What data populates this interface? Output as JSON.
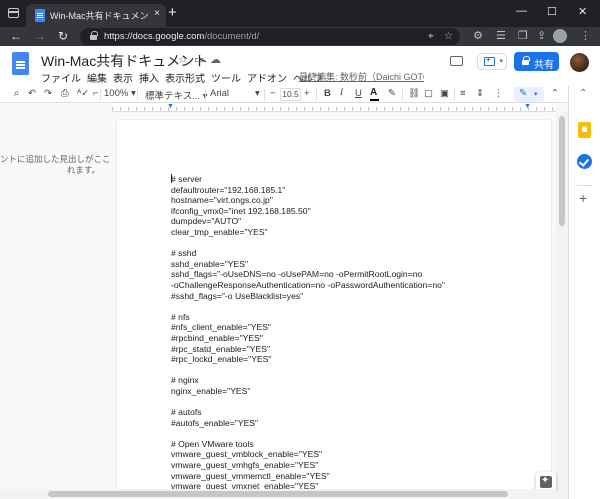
{
  "browser": {
    "tab_title": "Win-Mac共有ドキュメント - Google",
    "tab_close": "×",
    "new_tab": "+",
    "url_host": "https://docs.google.com",
    "url_path": "/document/d/",
    "window_controls": {
      "minimize": "—",
      "maximize": "☐",
      "close": "✕"
    },
    "nav": {
      "back": "←",
      "forward": "→",
      "reload": "↻"
    }
  },
  "docs": {
    "title": "Win-Mac共有ドキュメント",
    "menu": [
      "ファイル",
      "編集",
      "表示",
      "挿入",
      "表示形式",
      "ツール",
      "アドオン",
      "ヘルプ"
    ],
    "last_edit": "最終編集: 数秒前（Daichi GOTO）",
    "share_label": "共有"
  },
  "format_toolbar": {
    "zoom": "100%",
    "style": "標準テキス...",
    "font": "Arial",
    "font_size": "10.5",
    "bold": "B",
    "italic": "I",
    "underline": "U",
    "text_color": "A",
    "minus": "−",
    "plus": "+"
  },
  "outline": {
    "hint": "ントに追加した見出しがここ\nれます。"
  },
  "document": {
    "lines": [
      "# server",
      "defaultrouter=\"192.168.185.1\"",
      "hostname=\"virt.ongs.co.jp\"",
      "ifconfig_vmx0=\"inet 192.168.185.50\"",
      "dumpdev=\"AUTO\"",
      "clear_tmp_enable=\"YES\"",
      "",
      "# sshd",
      "sshd_enable=\"YES\"",
      "sshd_flags=\"-oUseDNS=no -oUsePAM=no -oPermitRootLogin=no",
      "-oChallengeResponseAuthentication=no -oPasswordAuthentication=no\"",
      "#sshd_flags=\"-o UseBlacklist=yes\"",
      "",
      "# nfs",
      "#nfs_client_enable=\"YES\"",
      "#rpcbind_enable=\"YES\"",
      "#rpc_statd_enable=\"YES\"",
      "#rpc_lockd_enable=\"YES\"",
      "",
      "# nginx",
      "nginx_enable=\"YES\"",
      "",
      "# autofs",
      "#autofs_enable=\"YES\"",
      "",
      "# Open VMware tools",
      "vmware_guest_vmblock_enable=\"YES\"",
      "vmware_guest_vmhgfs_enable=\"YES\"",
      "vmware_guest_vmmemctl_enable=\"YES\"",
      "vmware_guest_vmxnet_enable=\"YES\""
    ]
  },
  "colors": {
    "accent": "#1a73e8",
    "chrome_dark": "#202124",
    "chrome_toolbar": "#35363a",
    "docs_blue": "#4285f4",
    "keep_yellow": "#fbbc04"
  }
}
